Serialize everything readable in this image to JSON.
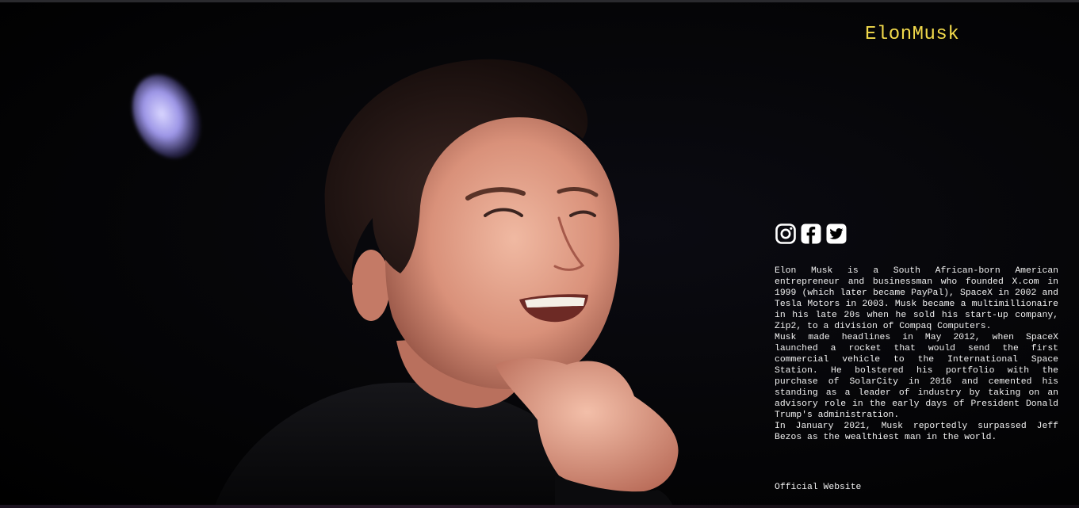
{
  "brand": {
    "logo_text": "ElonMusk",
    "accent_color": "#f1d94b"
  },
  "hero": {
    "image_subject": "smiling man with hand on chin against dark background"
  },
  "social": {
    "links": [
      {
        "icon": "instagram-icon"
      },
      {
        "icon": "facebook-icon"
      },
      {
        "icon": "twitter-icon"
      }
    ]
  },
  "bio": {
    "paragraphs": [
      "Elon Musk is a South African-born American entrepreneur and businessman who founded X.com in 1999 (which later became PayPal), SpaceX in 2002 and Tesla Motors in 2003. Musk became a multimillionaire in his late 20s when he sold his start-up company, Zip2, to a division of Compaq Computers.",
      "Musk made headlines in May 2012, when SpaceX launched a rocket that would send the first commercial vehicle to the International Space Station. He bolstered his portfolio with the purchase of SolarCity in 2016 and cemented his standing as a leader of industry by taking on an advisory role in the early days of President Donald Trump's administration.",
      "In January 2021, Musk reportedly surpassed Jeff Bezos as the wealthiest man in the world."
    ]
  },
  "footer": {
    "official_link_label": "Official Website"
  }
}
